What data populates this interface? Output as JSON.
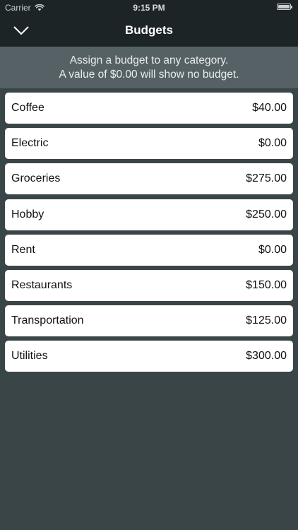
{
  "status_bar": {
    "carrier": "Carrier",
    "time": "9:15 PM",
    "battery_level": 1.0
  },
  "nav": {
    "title": "Budgets",
    "back_icon": "chevron-down-icon"
  },
  "info": {
    "line1": "Assign a budget to any category.",
    "line2": "A value of $0.00 will show no budget."
  },
  "budgets": [
    {
      "name": "Coffee",
      "amount": "$40.00"
    },
    {
      "name": "Electric",
      "amount": "$0.00"
    },
    {
      "name": "Groceries",
      "amount": "$275.00"
    },
    {
      "name": "Hobby",
      "amount": "$250.00"
    },
    {
      "name": "Rent",
      "amount": "$0.00"
    },
    {
      "name": "Restaurants",
      "amount": "$150.00"
    },
    {
      "name": "Transportation",
      "amount": "$125.00"
    },
    {
      "name": "Utilities",
      "amount": "$300.00"
    }
  ],
  "colors": {
    "background": "#3a4548",
    "nav_background": "#1c2426",
    "banner_background": "#566166",
    "row_background": "#ffffff"
  }
}
